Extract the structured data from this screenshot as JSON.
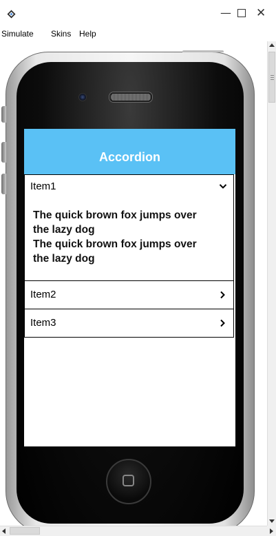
{
  "window": {
    "minimize_glyph": "—",
    "maximize_glyph": "",
    "close_glyph": "✕"
  },
  "menubar": {
    "items": [
      "Simulate",
      "Skins",
      "Help"
    ]
  },
  "app": {
    "title": "Accordion",
    "header_color": "#5ac1f5",
    "items": [
      {
        "label": "Item1",
        "expanded": true,
        "chevron": "⌄",
        "content": [
          "The quick brown fox jumps over",
          "the lazy dog",
          "The quick brown fox jumps over",
          "the lazy dog"
        ]
      },
      {
        "label": "Item2",
        "expanded": false,
        "chevron": "›"
      },
      {
        "label": "Item3",
        "expanded": false,
        "chevron": "›"
      }
    ]
  },
  "icons": {
    "app_icon": "app-icon",
    "camera": "camera-icon",
    "speaker": "speaker-grille",
    "home": "home-button-icon"
  }
}
